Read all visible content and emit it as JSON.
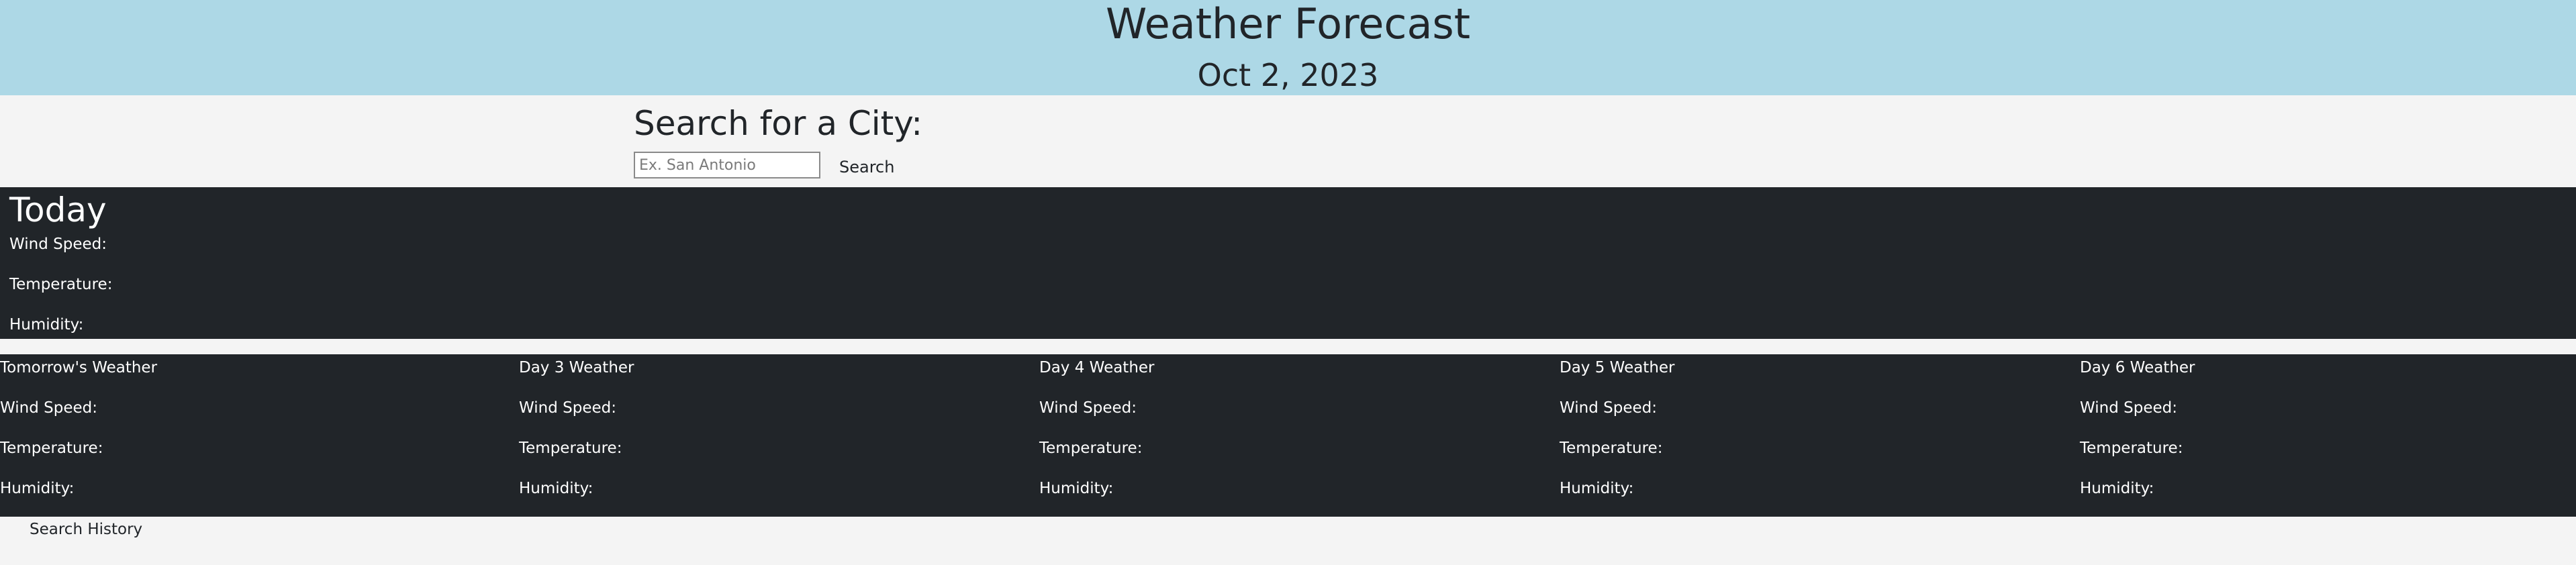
{
  "header": {
    "title": "Weather Forecast",
    "date": "Oct 2, 2023",
    "background_color": "#add8e6"
  },
  "search": {
    "heading": "Search for a City:",
    "placeholder": "Ex. San Antonio",
    "value": "",
    "button_label": "Search"
  },
  "today": {
    "title": "Today",
    "wind_label": "Wind Speed:",
    "temp_label": "Temperature:",
    "humidity_label": "Humidity:",
    "background_color": "#212529"
  },
  "forecast": {
    "days": [
      {
        "title": "Tomorrow's Weather",
        "wind_label": "Wind Speed:",
        "temp_label": "Temperature:",
        "humidity_label": "Humidity:"
      },
      {
        "title": "Day 3 Weather",
        "wind_label": "Wind Speed:",
        "temp_label": "Temperature:",
        "humidity_label": "Humidity:"
      },
      {
        "title": "Day 4 Weather",
        "wind_label": "Wind Speed:",
        "temp_label": "Temperature:",
        "humidity_label": "Humidity:"
      },
      {
        "title": "Day 5 Weather",
        "wind_label": "Wind Speed:",
        "temp_label": "Temperature:",
        "humidity_label": "Humidity:"
      },
      {
        "title": "Day 6 Weather",
        "wind_label": "Wind Speed:",
        "temp_label": "Temperature:",
        "humidity_label": "Humidity:"
      }
    ]
  },
  "history": {
    "label": "Search History"
  }
}
